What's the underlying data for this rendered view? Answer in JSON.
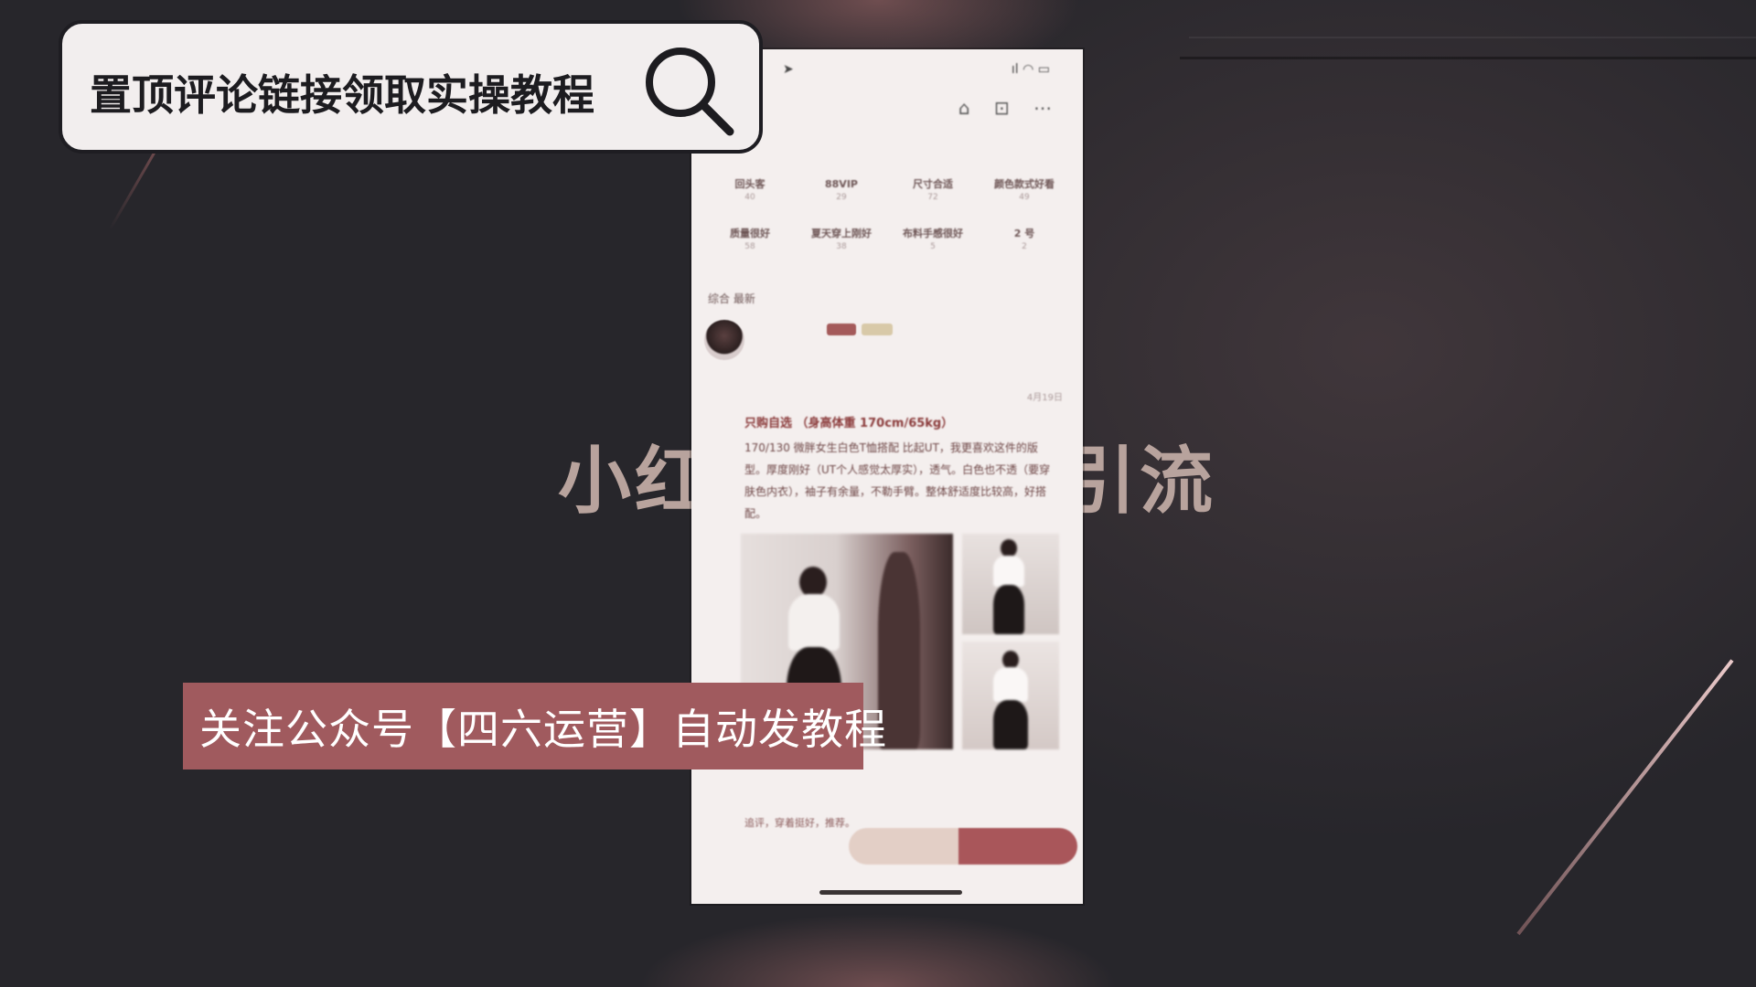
{
  "search_banner": {
    "text": "置顶评论链接领取实操教程",
    "icon": "search-icon"
  },
  "background_title": {
    "left": "小红",
    "right": "引流"
  },
  "follow_banner": {
    "text": "关注公众号【四六运营】自动发教程"
  },
  "phone": {
    "status_bar": {
      "icons": "ıl ◠ ▭"
    },
    "top_icons": "⌂ ⊡ ⋯",
    "tags": [
      {
        "label": "回头客",
        "count": "40"
      },
      {
        "label": "88VIP",
        "count": "29"
      },
      {
        "label": "尺寸合适",
        "count": "72"
      },
      {
        "label": "颜色款式好看",
        "count": "49"
      },
      {
        "label": "质量很好",
        "count": "58"
      },
      {
        "label": "夏天穿上刚好",
        "count": "38"
      },
      {
        "label": "布料手感很好",
        "count": "5"
      },
      {
        "label": "2 号",
        "count": "2"
      }
    ],
    "sort": {
      "label": "综合  最新"
    },
    "review": {
      "title": "只购自选 （身高体重 170cm/65kg）",
      "body": "170/130 微胖女生白色T恤搭配 比起UT，我更喜欢这件的版型。厚度刚好（UT个人感觉太厚实），透气。白色也不透（要穿肤色内衣），袖子有余量，不勒手臂。整体舒适度比较高，好搭配。",
      "date": "4月19日"
    },
    "comment": {
      "text": "追评，穿着挺好，推荐。"
    }
  },
  "colors": {
    "background": "#27262b",
    "banner_accent": "#a05a5e",
    "search_banner_bg": "#f2eeee"
  }
}
